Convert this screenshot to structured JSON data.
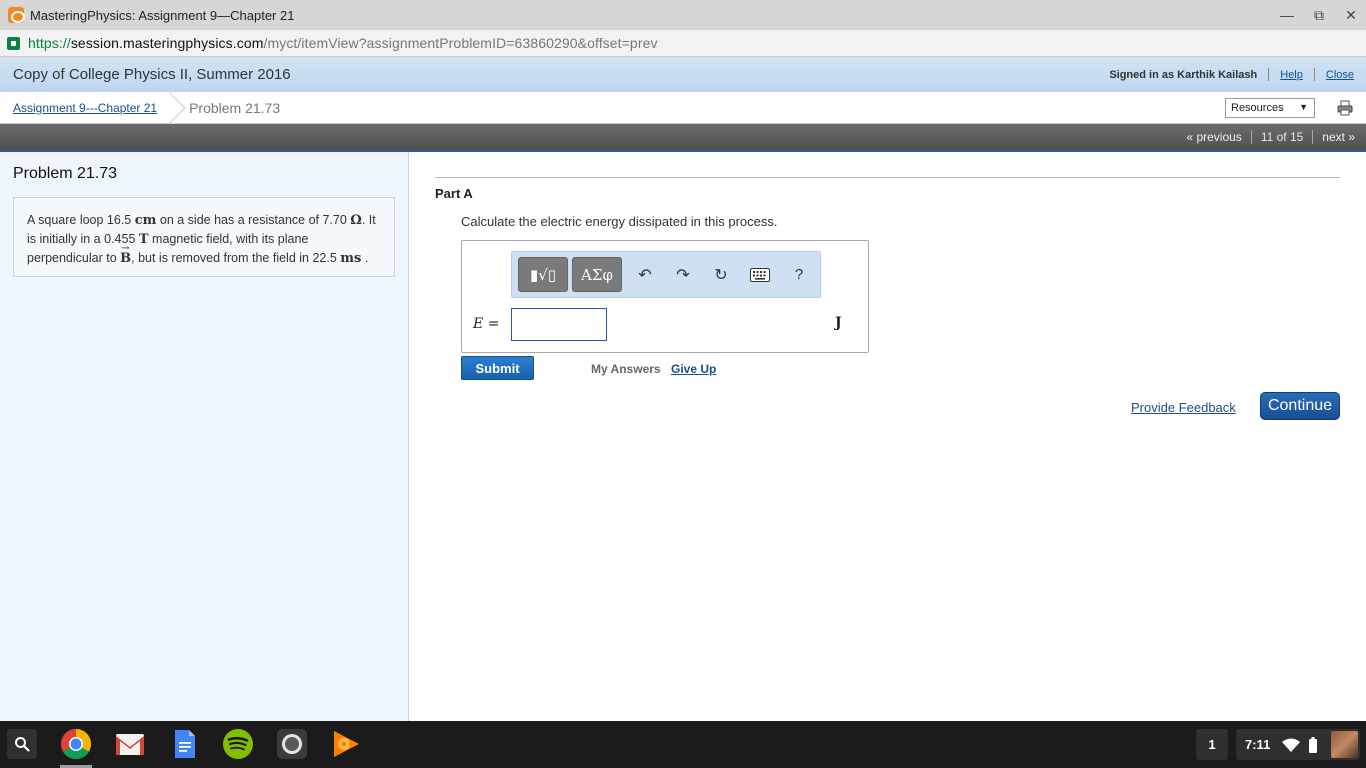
{
  "window": {
    "title": "MasteringPhysics: Assignment 9—Chapter 21",
    "controls": {
      "minimize": "—",
      "restore": "⧉",
      "close": "✕"
    }
  },
  "address_bar": {
    "scheme": "https://",
    "host": "session.masteringphysics.com",
    "path": "/myct/itemView?assignmentProblemID=63860290&offset=prev",
    "icon": "lock-icon"
  },
  "header": {
    "course_title": "Copy of College Physics II, Summer 2016",
    "signed_in": "Signed in as Karthik Kailash",
    "help_label": "Help",
    "close_label": "Close"
  },
  "breadcrumb": {
    "assignment_link": "Assignment 9---Chapter 21",
    "current": "Problem 21.73",
    "resources_label": "Resources"
  },
  "navigation": {
    "previous_label": "« previous",
    "position": "11 of 15",
    "next_label": "next »"
  },
  "problem": {
    "title": "Problem 21.73",
    "text": {
      "p1": "A square loop 16.5 ",
      "unit1": "cm",
      "p2": " on a side has a resistance of 7.70 ",
      "unit2": "Ω",
      "p3": ". It is initially in a 0.455 ",
      "unit3": "T",
      "p4": " magnetic field, with its plane perpendicular to ",
      "vector": "B",
      "p5": ", but is removed from the field in 22.5 ",
      "unit4": "ms",
      "p6": " ."
    }
  },
  "part_a": {
    "label": "Part A",
    "question": "Calculate the electric energy dissipated in this process.",
    "toolbar": {
      "templates_label": "▮√▯",
      "greek_label": "ΑΣφ",
      "undo": "↶",
      "redo": "↷",
      "reset": "↻",
      "help": "?"
    },
    "variable": "E",
    "equals": "=",
    "input_value": "",
    "unit": "J",
    "submit_label": "Submit",
    "my_answers_label": "My Answers",
    "give_up_label": "Give Up"
  },
  "footer_actions": {
    "provide_feedback_label": "Provide Feedback",
    "continue_label": "Continue"
  },
  "shelf": {
    "apps": [
      "chrome-icon",
      "gmail-icon",
      "docs-icon",
      "spotify-icon",
      "camera-icon",
      "play-music-icon"
    ],
    "badge": "1",
    "clock": "7:11"
  }
}
